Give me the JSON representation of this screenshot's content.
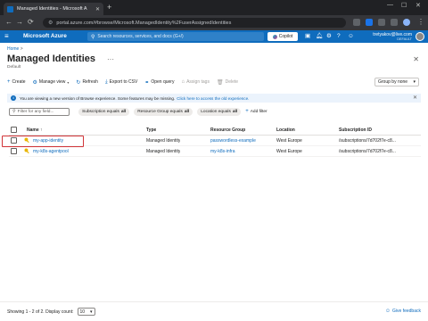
{
  "browser": {
    "tab_title": "Managed Identities - Microsoft A",
    "new_tab": "+",
    "url": "portal.azure.com/#browse/Microsoft.ManagedIdentity%2FuserAssignedIdentities",
    "nav": {
      "back": "←",
      "forward": "→",
      "reload": "⟳"
    },
    "window": {
      "min": "—",
      "max": "☐",
      "close": "✕"
    }
  },
  "azure_header": {
    "brand": "Microsoft Azure",
    "search_placeholder": "Search resources, services, and docs (G+/)",
    "copilot": "Copilot",
    "account_email": "tretyakov@live.com",
    "account_dir": "DEFAULT"
  },
  "breadcrumb": {
    "home": "Home",
    "sep": ">"
  },
  "page": {
    "title": "Managed Identities",
    "subtitle": "Default"
  },
  "toolbar": {
    "create": "Create",
    "manage_view": "Manage view",
    "refresh": "Refresh",
    "export_csv": "Export to CSV",
    "open_query": "Open query",
    "assign_tags": "Assign tags",
    "delete": "Delete",
    "group_by": "Group by none"
  },
  "banner": {
    "text": "You are viewing a new version of Browse experience. Some features may be missing.",
    "link": "Click here to access the old experience."
  },
  "filters": {
    "search_placeholder": "Filter for any field...",
    "pills": [
      {
        "label": "Subscription equals",
        "value": "all"
      },
      {
        "label": "Resource Group equals",
        "value": "all"
      },
      {
        "label": "Location equals",
        "value": "all"
      }
    ],
    "add_filter": "Add filter"
  },
  "table": {
    "columns": [
      "Name ↑",
      "Type",
      "Resource Group",
      "Location",
      "Subscription ID"
    ],
    "rows": [
      {
        "name": "my-app-identity",
        "type": "Managed Identity",
        "rg": "passwordless-example",
        "location": "West Europe",
        "sub": "/subscriptions/7d702f7e-c8..."
      },
      {
        "name": "my-k8s-agentpool",
        "type": "Managed Identity",
        "rg": "my-k8s-infra",
        "location": "West Europe",
        "sub": "/subscriptions/7d702f7e-c8..."
      }
    ]
  },
  "footer": {
    "showing": "Showing 1 - 2 of 2. Display count:",
    "display_count": "10",
    "feedback": "Give feedback"
  },
  "colors": {
    "accent": "#0f6cbd",
    "highlight": "#d13438"
  }
}
